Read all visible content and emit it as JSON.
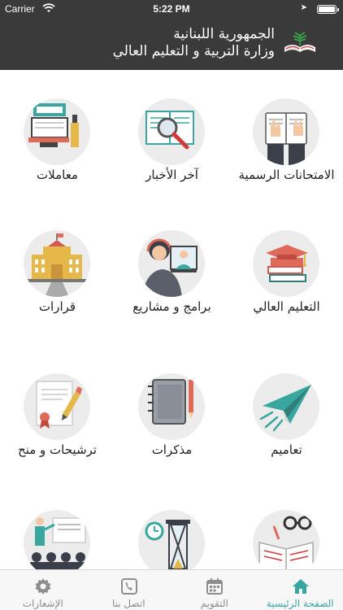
{
  "status_bar": {
    "carrier": "Carrier",
    "time": "5:22 PM"
  },
  "header": {
    "title_line1": "الجمهورية اللبنانية",
    "title_line2": "وزارة التربية و التعليم العالي"
  },
  "tiles": [
    {
      "label": "الامتحانات الرسمية",
      "icon": "exam-hands-book-icon"
    },
    {
      "label": "آخر الأخبار",
      "icon": "newspaper-magnifier-icon"
    },
    {
      "label": "معاملات",
      "icon": "transactions-desk-icon"
    },
    {
      "label": "التعليم العالي",
      "icon": "books-mortarboard-icon"
    },
    {
      "label": "برامج و مشاريع",
      "icon": "video-conference-icon"
    },
    {
      "label": "قرارات",
      "icon": "government-building-icon"
    },
    {
      "label": "تعاميم",
      "icon": "paper-plane-icon"
    },
    {
      "label": "مذكرات",
      "icon": "notebook-pencil-icon"
    },
    {
      "label": "ترشيحات و منح",
      "icon": "certificate-pencil-icon"
    },
    {
      "label": "",
      "icon": "open-book-glasses-icon"
    },
    {
      "label": "",
      "icon": "hourglass-clock-icon"
    },
    {
      "label": "",
      "icon": "presentation-audience-icon"
    }
  ],
  "tabbar": {
    "items": [
      {
        "label": "الصفحة الرئيسية",
        "icon": "home-icon",
        "active": true
      },
      {
        "label": "التقويم",
        "icon": "calendar-icon",
        "active": false
      },
      {
        "label": "اتصل بنا",
        "icon": "phone-icon",
        "active": false
      },
      {
        "label": "الإشعارات",
        "icon": "gear-icon",
        "active": false
      }
    ]
  },
  "colors": {
    "header_bg": "#3a3a3a",
    "accent": "#3aa6a0",
    "circle_bg": "#ececec"
  }
}
